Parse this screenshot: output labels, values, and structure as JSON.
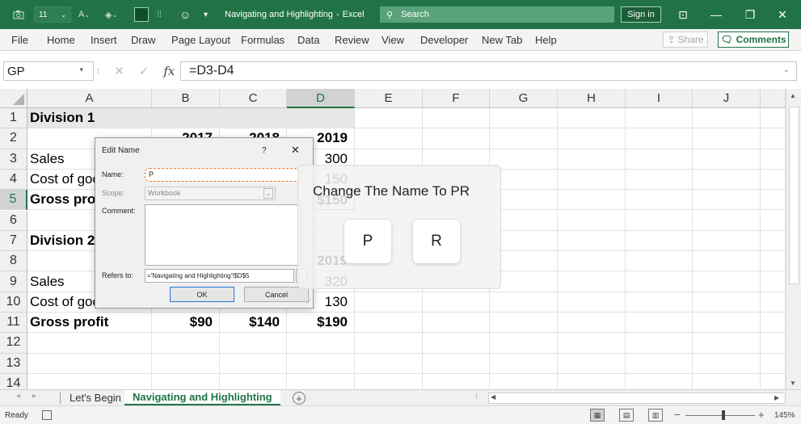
{
  "titlebar": {
    "font_size_box": "11",
    "doc_title": "Navigating and Highlighting",
    "app_sep": "-",
    "app_name": "Excel",
    "search_placeholder": "Search",
    "sign_in": "Sign in"
  },
  "ribbon": {
    "tabs": [
      "File",
      "Home",
      "Insert",
      "Draw",
      "Page Layout",
      "Formulas",
      "Data",
      "Review",
      "View",
      "Developer",
      "New Tab",
      "Help"
    ],
    "share": "Share",
    "comments": "Comments"
  },
  "formula_bar": {
    "name_box": "GP",
    "fx": "fx",
    "formula": "=D3-D4"
  },
  "columns": [
    "A",
    "B",
    "C",
    "D",
    "E",
    "F",
    "G",
    "H",
    "I",
    "J"
  ],
  "selected_column": "D",
  "selected_row": 5,
  "rows": [
    {
      "n": "1",
      "a": "Division 1",
      "b": "",
      "c": "",
      "d": ""
    },
    {
      "n": "2",
      "a": "",
      "b": "2017",
      "c": "2018",
      "d": "2019"
    },
    {
      "n": "3",
      "a": "Sales",
      "b": "",
      "c": "",
      "d": "300"
    },
    {
      "n": "4",
      "a": "Cost of goods",
      "b": "",
      "c": "",
      "d": "150"
    },
    {
      "n": "5",
      "a": "Gross profit",
      "b": "",
      "c": "",
      "d": "$150"
    },
    {
      "n": "6",
      "a": "",
      "b": "",
      "c": "",
      "d": ""
    },
    {
      "n": "7",
      "a": "Division 2",
      "b": "",
      "c": "",
      "d": ""
    },
    {
      "n": "8",
      "a": "",
      "b": "",
      "c": "",
      "d": "2019"
    },
    {
      "n": "9",
      "a": "Sales",
      "b": "",
      "c": "",
      "d": "320"
    },
    {
      "n": "10",
      "a": "Cost of goods",
      "b": "",
      "c": "",
      "d": "130"
    },
    {
      "n": "11",
      "a": "Gross profit",
      "b": "$90",
      "c": "$140",
      "d": "$190"
    },
    {
      "n": "12",
      "a": "",
      "b": "",
      "c": "",
      "d": ""
    },
    {
      "n": "13",
      "a": "",
      "b": "",
      "c": "",
      "d": ""
    },
    {
      "n": "14",
      "a": "",
      "b": "",
      "c": "",
      "d": ""
    }
  ],
  "bold_rows": [
    "1",
    "2",
    "5",
    "7",
    "8",
    "11"
  ],
  "sheets": {
    "tabs": [
      "Let's Begin",
      "Navigating and Highlighting"
    ],
    "active": "Navigating and Highlighting"
  },
  "status": {
    "ready": "Ready",
    "zoom": "145%"
  },
  "dialog": {
    "title": "Edit Name",
    "help": "?",
    "close": "✕",
    "name_label": "Name:",
    "name_value": "P",
    "scope_label": "Scope:",
    "scope_value": "Workbook",
    "comment_label": "Comment:",
    "refers_label": "Refers to:",
    "refers_value": "='Navigating and Highlighting'!$D$5",
    "ok": "OK",
    "cancel": "Cancel"
  },
  "overlay": {
    "instruction": "Change The Name To PR",
    "keys": [
      "P",
      "R"
    ]
  },
  "colors": {
    "excel_green": "#217346",
    "focus_orange": "#f07a2b"
  }
}
